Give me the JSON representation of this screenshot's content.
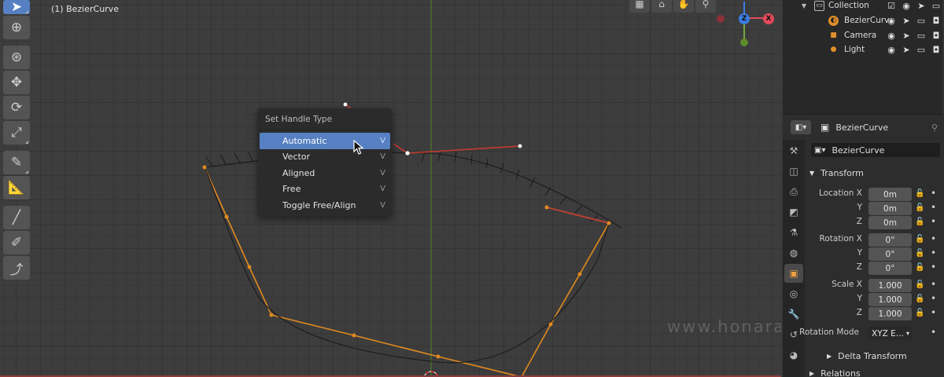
{
  "viewport": {
    "object_label": "(1) BezierCurve",
    "watermark": "www.honaramiz.com",
    "header_icons": [
      "grid-icon",
      "camera-view-icon",
      "hand-icon",
      "zoom-icon"
    ],
    "gizmo": {
      "z_label": "Z",
      "x_label": "X",
      "colors": {
        "x": "#e24b5a",
        "y": "#8ccc3c",
        "z": "#3b7ce0"
      }
    }
  },
  "toolbar": {
    "tools": [
      "select-box-icon",
      "cursor-icon",
      "move-icon",
      "move-arrows-icon",
      "rotate-icon",
      "scale-icon",
      "annotate-icon",
      "measure-icon",
      "draw-icon",
      "pen-icon",
      "extrude-icon",
      "tilt-icon"
    ]
  },
  "popup": {
    "title": "Set Handle Type",
    "items": [
      {
        "label": "Automatic",
        "key": "V",
        "highlighted": true
      },
      {
        "label": "Vector",
        "key": "V",
        "highlighted": false
      },
      {
        "label": "Aligned",
        "key": "V",
        "highlighted": false
      },
      {
        "label": "Free",
        "key": "V",
        "highlighted": false
      },
      {
        "label": "Toggle Free/Align",
        "key": "V",
        "highlighted": false
      }
    ]
  },
  "outliner": {
    "rows": [
      {
        "name": "Collection",
        "icon": "collection-icon"
      },
      {
        "name": "BezierCurv",
        "icon": "curve-icon"
      },
      {
        "name": "Camera",
        "icon": "camera-icon"
      },
      {
        "name": "Light",
        "icon": "light-icon"
      }
    ]
  },
  "properties": {
    "header_object": "BezierCurve",
    "object_name": "BezierCurve",
    "transform_title": "Transform",
    "location_label": "Location X",
    "rotation_label": "Rotation X",
    "scale_label": "Scale X",
    "y_label": "Y",
    "z_label": "Z",
    "location": [
      "0m",
      "0m",
      "0m"
    ],
    "rotation": [
      "0°",
      "0°",
      "0°"
    ],
    "scale": [
      "1.000",
      "1.000",
      "1.000"
    ],
    "rotation_mode_label": "Rotation Mode",
    "rotation_mode_value": "XYZ E...",
    "delta_transform": "Delta Transform",
    "relations": "Relations"
  }
}
